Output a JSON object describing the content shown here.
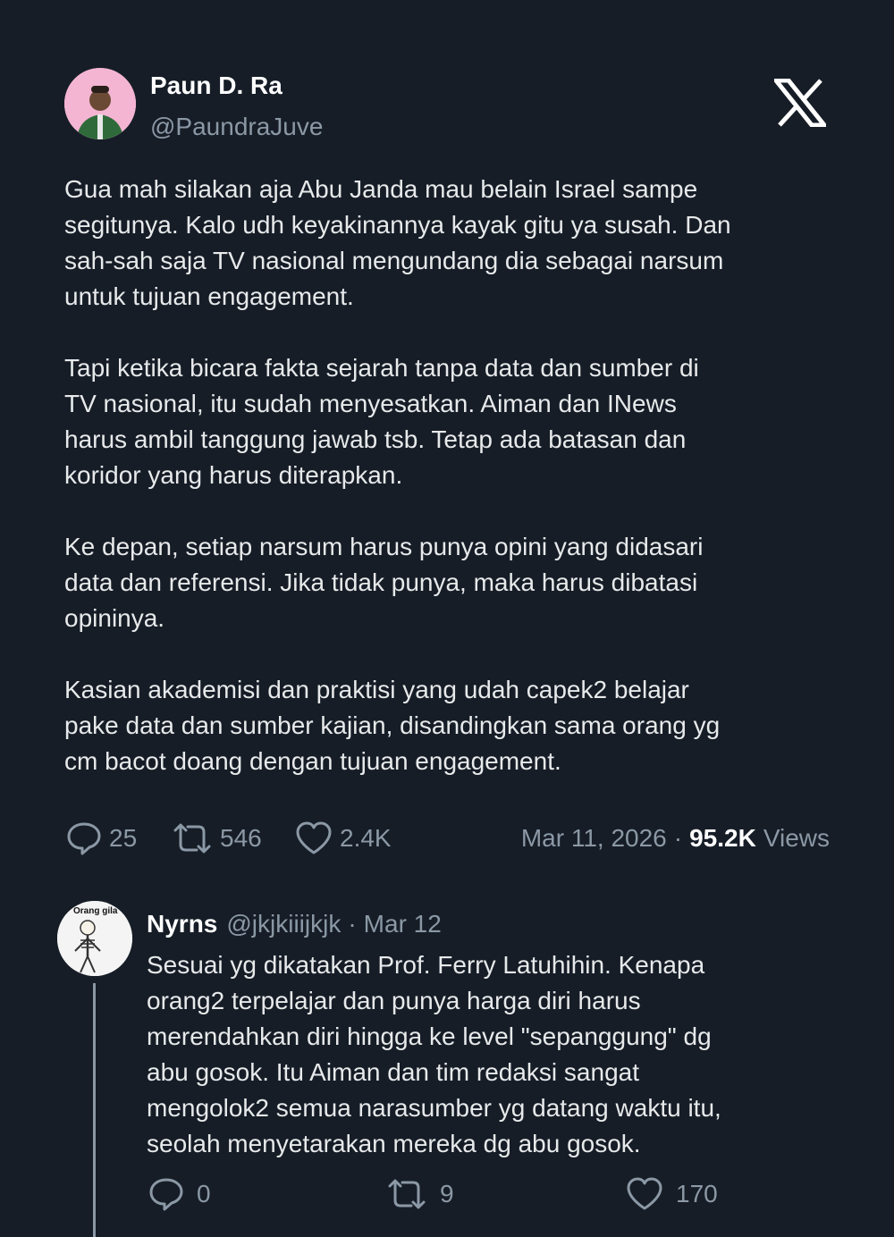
{
  "tweet": {
    "author_name": "Paun D. Ra",
    "author_handle": "@PaundraJuve",
    "text": "Gua mah silakan aja Abu Janda mau belain Israel sampe\nsegitunya. Kalo udh keyakinannya kayak gitu ya susah. Dan\nsah-sah saja TV nasional mengundang dia sebagai narsum\nuntuk tujuan engagement.\n\nTapi ketika bicara fakta sejarah tanpa data dan sumber di\nTV nasional, itu sudah menyesatkan. Aiman dan INews\nharus ambil tanggung jawab tsb. Tetap ada batasan dan\nkoridor yang harus diterapkan.\n\nKe depan, setiap narsum harus punya opini yang didasari\ndata dan referensi. Jika tidak punya, maka harus dibatasi\nopininya.\n\nKasian akademisi dan praktisi yang udah capek2 belajar\npake data dan sumber kajian, disandingkan sama orang yg\ncm bacot doang dengan tujuan engagement.",
    "replies": "25",
    "reposts": "546",
    "likes": "2.4K",
    "date": "Mar 11, 2026",
    "separator": "·",
    "views_count": "95.2K",
    "views_label": "Views"
  },
  "reply": {
    "avatar_caption": "Orang gila",
    "name": "Nyrns",
    "handle": "@jkjkiiijkjk",
    "separator": "·",
    "date": "Mar 12",
    "text": "Sesuai yg dikatakan Prof. Ferry Latuhihin. Kenapa\norang2 terpelajar dan punya harga diri harus\nmerendahkan diri hingga ke level \"sepanggung\" dg\nabu gosok. Itu Aiman dan tim redaksi sangat\nmengolok2 semua narasumber yg datang waktu itu,\nseolah menyetarakan mereka dg abu gosok.",
    "replies": "0",
    "reposts": "9",
    "likes": "170"
  },
  "colors": {
    "background": "#161d27",
    "text": "#e7e9ea",
    "muted": "#8b98a5"
  },
  "icons": [
    "x-logo-icon",
    "reply-icon",
    "repost-icon",
    "like-icon"
  ]
}
